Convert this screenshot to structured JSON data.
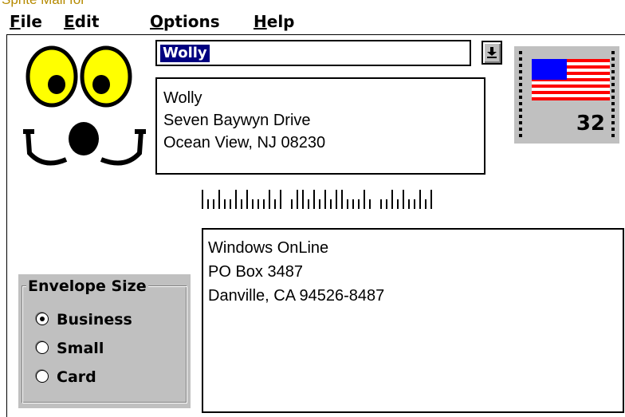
{
  "title_fragment": "Sprite Mail for",
  "menu": {
    "file": "ile",
    "file_mnemonic": "F",
    "edit": "dit",
    "edit_mnemonic": "E",
    "options": "ptions",
    "options_mnemonic": "O",
    "help": "elp",
    "help_mnemonic": "H"
  },
  "recipient_combo": {
    "value": "Wolly"
  },
  "return_address": {
    "line1": "Wolly",
    "line2": "Seven Baywyn Drive",
    "line3": "Ocean View, NJ 08230"
  },
  "stamp": {
    "value": "32"
  },
  "delivery_address": {
    "line1": "Windows OnLine",
    "line2": "PO Box 3487",
    "line3": "Danville, CA 94526-8487"
  },
  "envelope_size": {
    "legend": "Envelope Size",
    "options": [
      {
        "label": "Business",
        "checked": true
      },
      {
        "label": "Small",
        "checked": false
      },
      {
        "label": "Card",
        "checked": false
      }
    ]
  },
  "colors": {
    "selection": "#000080",
    "panel": "#c0c0c0",
    "title_text": "#b58a00",
    "face_yellow": "#ffff00"
  }
}
